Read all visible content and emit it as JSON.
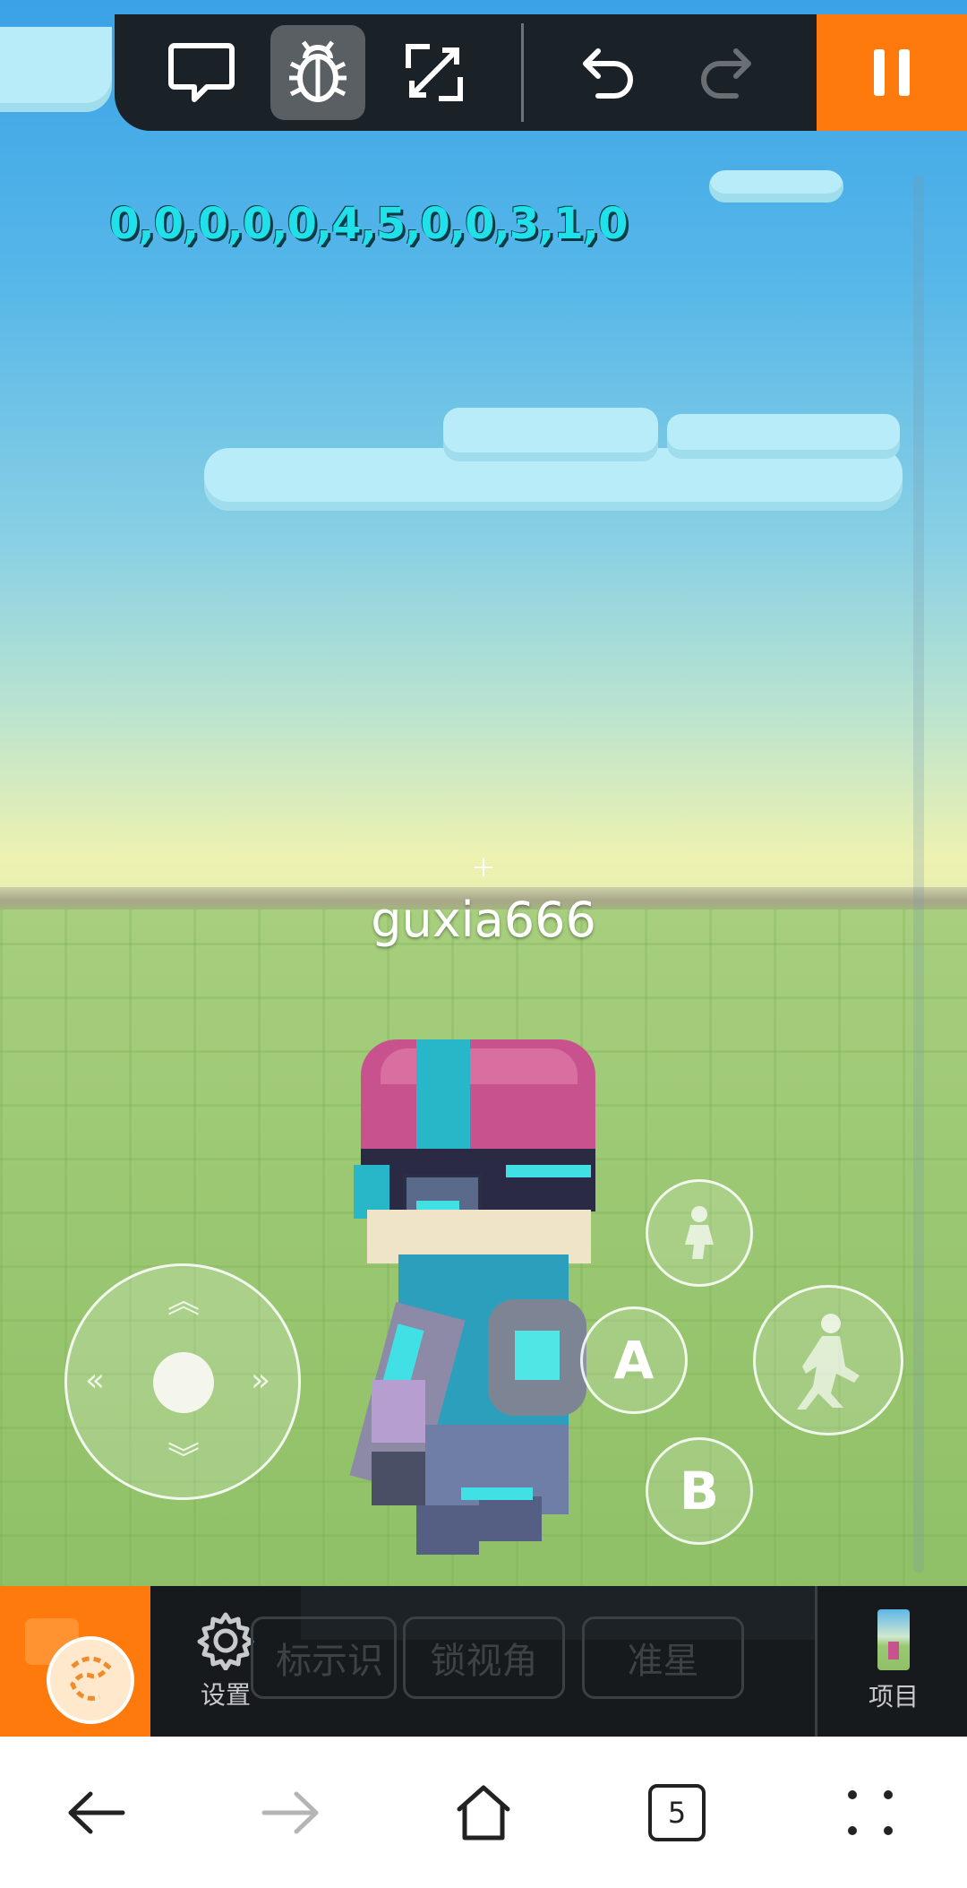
{
  "hud": {
    "debug_values": "0,0,0,0,0,4,5,0,0,3,1,0"
  },
  "player": {
    "name": "guxia666"
  },
  "toolbar": {
    "icons": [
      "chat-icon",
      "bug-icon",
      "expand-icon",
      "undo-icon",
      "redo-icon"
    ],
    "active": "bug-icon",
    "accent": "#ff7a0d"
  },
  "controls": {
    "button_a": "A",
    "button_b": "B"
  },
  "bottom_bar": {
    "settings_label": "设置",
    "ghost_buttons": [
      "标示识",
      "锁视角",
      "准星"
    ],
    "project_label": "项目"
  },
  "nav": {
    "tab_count": "5"
  },
  "colors": {
    "accent": "#ff7a0d",
    "hud_text": "#20e0ea",
    "toolbar_bg": "#1a2127"
  }
}
